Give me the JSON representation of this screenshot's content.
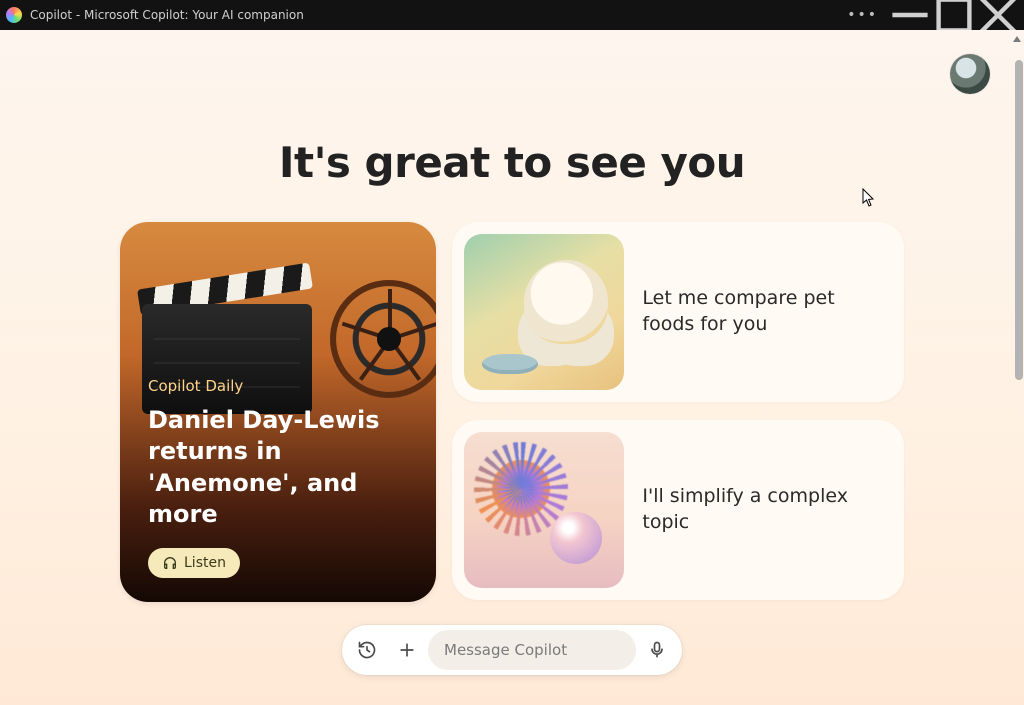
{
  "window": {
    "title": "Copilot - Microsoft Copilot: Your AI companion"
  },
  "greeting": "It's great to see you",
  "daily": {
    "label": "Copilot Daily",
    "headline": "Daniel Day-Lewis returns in 'Anemone', and more",
    "listen_label": "Listen"
  },
  "suggestions": [
    {
      "text": "Let me compare pet foods for you"
    },
    {
      "text": "I'll simplify a complex topic"
    }
  ],
  "input": {
    "placeholder": "Message Copilot"
  }
}
